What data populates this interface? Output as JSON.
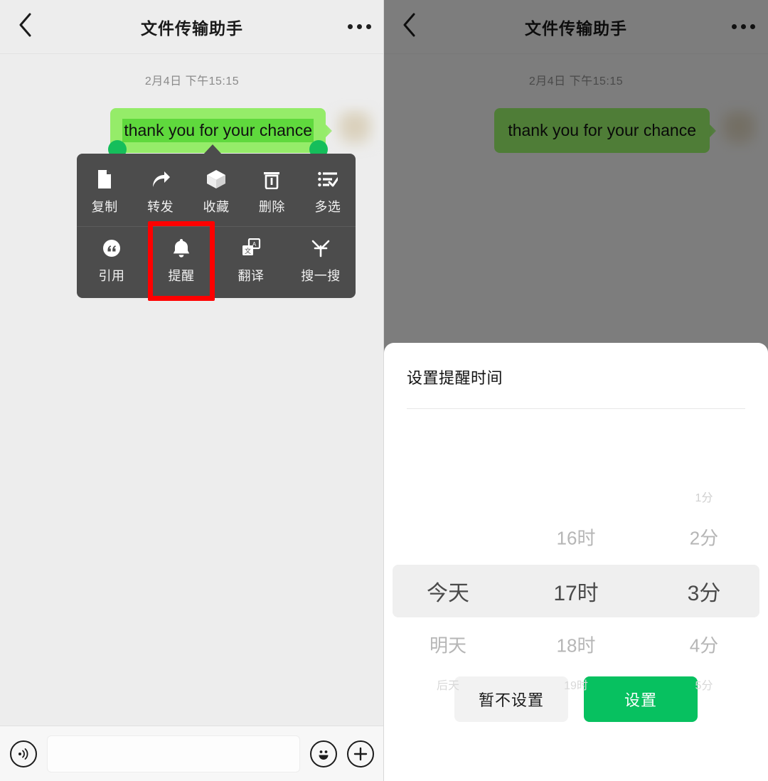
{
  "header": {
    "title": "文件传输助手",
    "back_icon": "chevron-left-icon",
    "more_icon": "more-dots-icon"
  },
  "chat": {
    "timestamp": "2月4日 下午15:15",
    "message": {
      "text": "thank you for your chance",
      "selected": true,
      "bubble_color": "#95EC69",
      "selection_color": "#5FD93D",
      "handle_color": "#15BE5B"
    }
  },
  "context_menu": {
    "background": "#4C4C4C",
    "highlight_color": "#FF0000",
    "highlighted_item": "提醒",
    "rows": [
      [
        {
          "label": "复制",
          "icon": "document-icon"
        },
        {
          "label": "转发",
          "icon": "forward-arrow-icon"
        },
        {
          "label": "收藏",
          "icon": "box-icon"
        },
        {
          "label": "删除",
          "icon": "trash-icon"
        },
        {
          "label": "多选",
          "icon": "list-check-icon"
        }
      ],
      [
        {
          "label": "引用",
          "icon": "quote-icon"
        },
        {
          "label": "提醒",
          "icon": "bell-icon"
        },
        {
          "label": "翻译",
          "icon": "translate-icon"
        },
        {
          "label": "搜一搜",
          "icon": "search-star-icon"
        }
      ]
    ]
  },
  "input_bar": {
    "voice_icon": "voice-wave-icon",
    "text_value": "",
    "text_placeholder": "",
    "emoji_icon": "smiley-icon",
    "plus_icon": "plus-icon"
  },
  "sheet": {
    "title": "设置提醒时间",
    "picker": {
      "columns": [
        {
          "name": "day",
          "items": [
            "",
            "",
            "今天",
            "明天",
            "后天"
          ],
          "selected_index": 2,
          "selected_value": "今天"
        },
        {
          "name": "hour",
          "items": [
            "",
            "16时",
            "17时",
            "18时",
            "19时"
          ],
          "selected_index": 2,
          "selected_value": "17时"
        },
        {
          "name": "minute",
          "items": [
            "1分",
            "2分",
            "3分",
            "4分",
            "5分"
          ],
          "selected_index": 2,
          "selected_value": "3分"
        }
      ],
      "selected_summary": "今天 17时 3分",
      "band_color": "#EFEFEF"
    },
    "buttons": {
      "secondary_label": "暂不设置",
      "primary_label": "设置",
      "primary_color": "#07C160"
    }
  }
}
